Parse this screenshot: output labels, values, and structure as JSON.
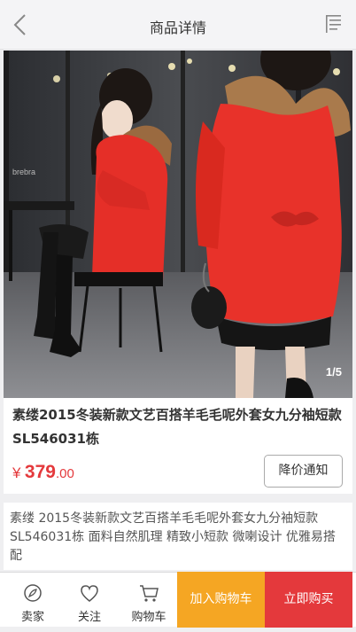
{
  "header": {
    "title": "商品详情"
  },
  "gallery": {
    "pager": "1/5",
    "watermark_text": "brebra"
  },
  "product": {
    "name": "素缕2015冬装新款文艺百搭羊毛毛呢外套女九分袖短款SL546031栋",
    "price_symbol": "¥",
    "price_integer": "379",
    "price_decimal": ".00",
    "notify_label": "降价通知",
    "description": "素缕 2015冬装新款文艺百搭羊毛毛呢外套女九分袖短款SL546031栋 面料自然肌理 精致小短款 微喇设计 优雅易搭配"
  },
  "bottom_bar": {
    "tabs": [
      {
        "label": "卖家",
        "icon": "seller-icon"
      },
      {
        "label": "关注",
        "icon": "heart-icon"
      },
      {
        "label": "购物车",
        "icon": "cart-icon"
      }
    ],
    "add_to_cart_label": "加入购物车",
    "buy_now_label": "立即购买"
  },
  "colors": {
    "accent_red": "#e4393c",
    "accent_orange": "#f5a623"
  }
}
